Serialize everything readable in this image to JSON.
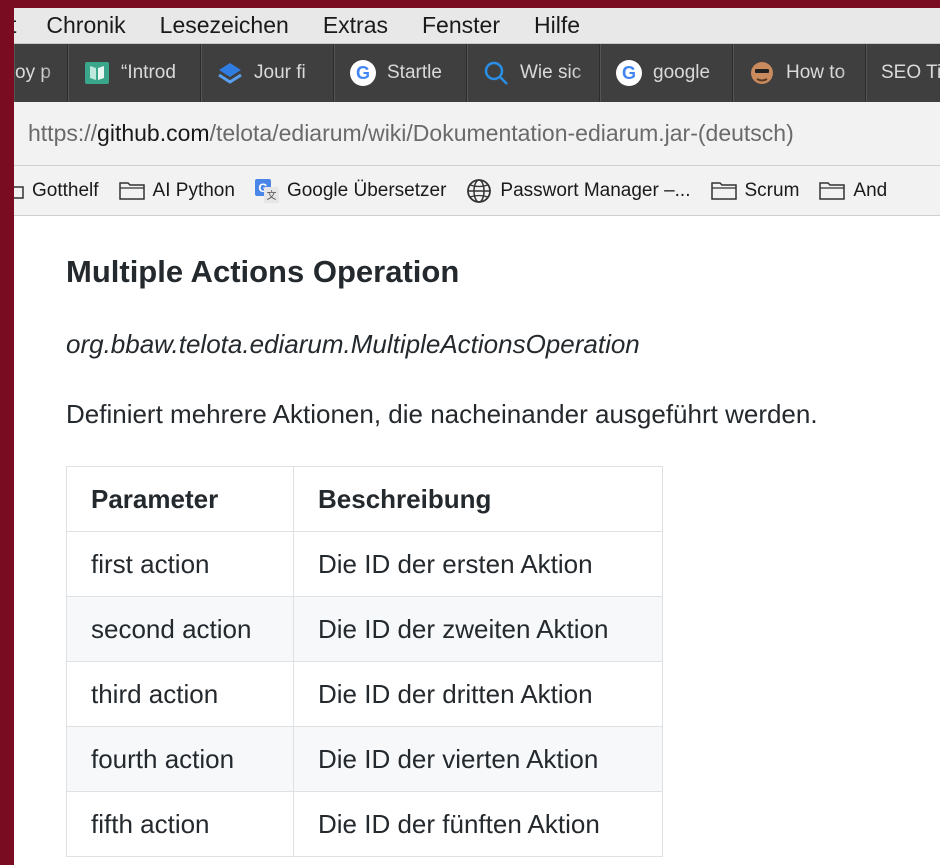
{
  "menubar": {
    "items": [
      "t",
      "Chronik",
      "Lesezeichen",
      "Extras",
      "Fenster",
      "Hilfe"
    ]
  },
  "tabs": [
    {
      "label": "oy p",
      "icon": "none"
    },
    {
      "label": "“Introd",
      "icon": "book-icon"
    },
    {
      "label": "Jour fi",
      "icon": "stack-icon"
    },
    {
      "label": "Startle",
      "icon": "google-icon"
    },
    {
      "label": "Wie sic",
      "icon": "magnifier-icon"
    },
    {
      "label": "google",
      "icon": "google-icon"
    },
    {
      "label": "How to",
      "icon": "avatar-icon"
    },
    {
      "label": "SEO Ti",
      "icon": "none"
    }
  ],
  "address": {
    "prefix": "https://",
    "host": "github.com",
    "path": "/telota/ediarum/wiki/Dokumentation-ediarum.jar-(deutsch)"
  },
  "bookmarks": [
    {
      "label": "Gotthelf",
      "icon": "folder-icon"
    },
    {
      "label": "AI Python",
      "icon": "folder-icon"
    },
    {
      "label": "Google Übersetzer",
      "icon": "translate-icon"
    },
    {
      "label": "Passwort Manager –...",
      "icon": "globe-icon"
    },
    {
      "label": "Scrum",
      "icon": "folder-icon"
    },
    {
      "label": "And",
      "icon": "folder-icon"
    }
  ],
  "page": {
    "heading": "Multiple Actions Operation",
    "classname": "org.bbaw.telota.ediarum.MultipleActionsOperation",
    "description": "Definiert mehrere Aktionen, die nacheinander ausgeführt werden.",
    "table": {
      "headers": [
        "Parameter",
        "Beschreibung"
      ],
      "rows": [
        [
          "first action",
          "Die ID der ersten Aktion"
        ],
        [
          "second action",
          "Die ID der zweiten Aktion"
        ],
        [
          "third action",
          "Die ID der dritten Aktion"
        ],
        [
          "fourth action",
          "Die ID der vierten Aktion"
        ],
        [
          "fifth action",
          "Die ID der fünften Aktion"
        ]
      ]
    }
  },
  "colors": {
    "desktop": "#7a0c22",
    "tabstrip": "#3f3f3f",
    "text": "#24292e",
    "table_border": "#dfe2e5",
    "table_alt_row": "#f6f8fa"
  }
}
